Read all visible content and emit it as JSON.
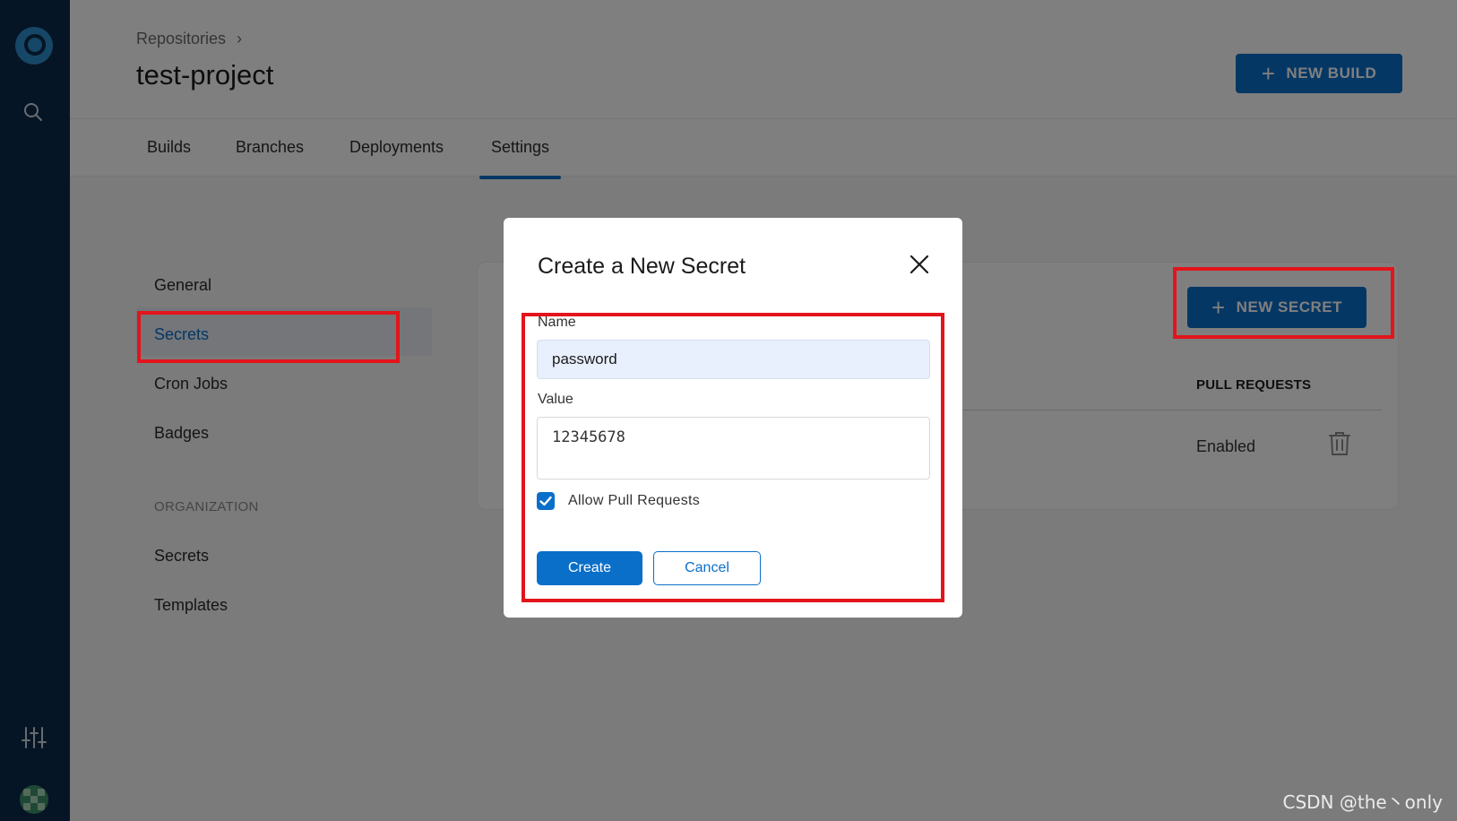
{
  "breadcrumb": {
    "root": "Repositories",
    "separator": "›"
  },
  "repo": {
    "title": "test-project"
  },
  "header": {
    "new_build_label": "NEW BUILD"
  },
  "tabs": [
    {
      "label": "Builds"
    },
    {
      "label": "Branches"
    },
    {
      "label": "Deployments"
    },
    {
      "label": "Settings"
    }
  ],
  "settings_nav": {
    "repo_items": [
      {
        "label": "General"
      },
      {
        "label": "Secrets"
      },
      {
        "label": "Cron Jobs"
      },
      {
        "label": "Badges"
      }
    ],
    "org_section_label": "ORGANIZATION",
    "org_items": [
      {
        "label": "Secrets"
      },
      {
        "label": "Templates"
      }
    ]
  },
  "secrets_panel": {
    "new_secret_label": "NEW SECRET",
    "column_pull_requests": "PULL REQUESTS",
    "row_pull_requests_value": "Enabled"
  },
  "modal": {
    "title": "Create a New Secret",
    "name_label": "Name",
    "name_value": "password",
    "value_label": "Value",
    "value_value": "12345678",
    "allow_pr_label": "Allow Pull Requests",
    "allow_pr_checked": true,
    "create_label": "Create",
    "cancel_label": "Cancel"
  },
  "watermark": "CSDN @the丶only",
  "colors": {
    "primary": "#0a6fc8",
    "sidebar": "#0b2a4a",
    "highlight_box": "#e3141b"
  }
}
